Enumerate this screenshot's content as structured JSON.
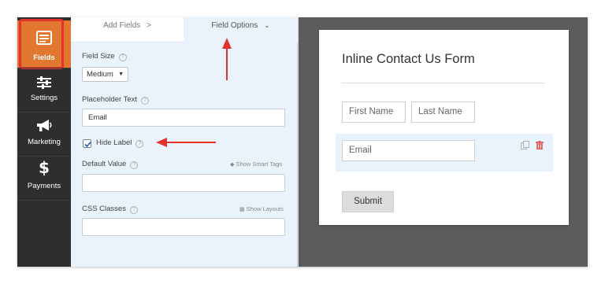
{
  "sidebar": {
    "items": [
      {
        "label": "Fields",
        "icon": "fields-icon",
        "active": true
      },
      {
        "label": "Settings",
        "icon": "sliders-icon",
        "active": false
      },
      {
        "label": "Marketing",
        "icon": "megaphone-icon",
        "active": false
      },
      {
        "label": "Payments",
        "icon": "dollar-icon",
        "active": false
      }
    ]
  },
  "tabs": {
    "add_fields": "Add Fields",
    "add_fields_chevron": ">",
    "field_options": "Field Options",
    "field_options_chevron": "⌄"
  },
  "options": {
    "field_size": {
      "label": "Field Size",
      "value": "Medium",
      "caret": "▼"
    },
    "placeholder": {
      "label": "Placeholder Text",
      "value": "Email"
    },
    "hide_label": {
      "label": "Hide Label",
      "checked": true
    },
    "default_value": {
      "label": "Default Value",
      "link": "Show Smart Tags",
      "value": ""
    },
    "css_classes": {
      "label": "CSS Classes",
      "link": "Show Layouts",
      "value": ""
    },
    "help_glyph": "?"
  },
  "preview": {
    "title": "Inline Contact Us Form",
    "first_name": "First Name",
    "last_name": "Last Name",
    "email": "Email",
    "submit": "Submit"
  },
  "colors": {
    "accent": "#e27730",
    "annotation": "#e5322d",
    "sidebar_bg": "#2e2e2e",
    "panel_bg": "#eaf3fb",
    "preview_bg": "#5c5c5c"
  }
}
